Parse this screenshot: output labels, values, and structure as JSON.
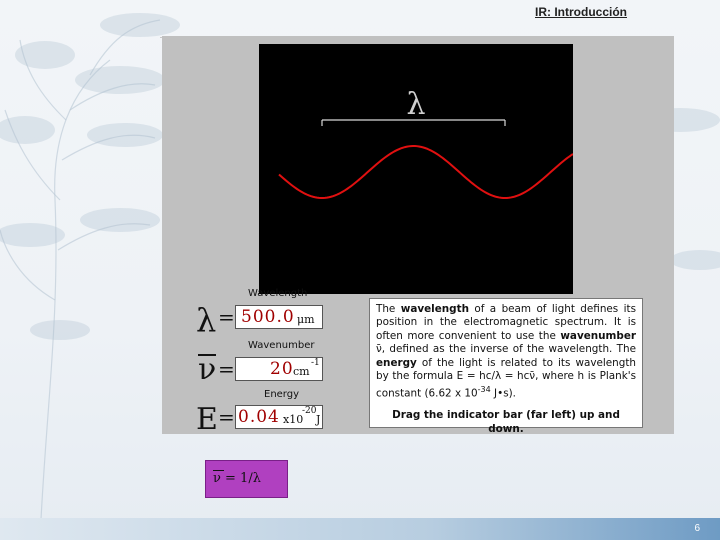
{
  "slide": {
    "title": "IR: Introducción",
    "page_number": "6"
  },
  "wave_panel": {
    "lambda_symbol": "λ",
    "wave_color": "#e01010"
  },
  "fields": {
    "wavelength": {
      "label": "Wavelength",
      "symbol": "λ",
      "equals": "=",
      "value": "500.0",
      "unit": "μm"
    },
    "wavenumber": {
      "label": "Wavenumber",
      "symbol": "ν",
      "equals": "=",
      "value": "20",
      "unit": "cm",
      "unit_exp": "-1"
    },
    "energy": {
      "label": "Energy",
      "symbol": "E",
      "equals": "=",
      "value": "0.04",
      "unit_prefix": "x10",
      "unit_exp": "-20",
      "unit": "J"
    }
  },
  "description": {
    "p1_a": "The ",
    "p1_b": "wavelength",
    "p1_c": " of a beam of light defines its position in the electromagnetic spectrum. It is often more convenient to use the ",
    "p1_d": "wavenumber",
    "p1_e": " ν̄, defined as the inverse of the wavelength. The ",
    "p1_f": "energy",
    "p1_g": " of the light is related to its wavelength by the formula E = hc/λ = hcν̄, where h is Plank's constant (6.62 x 10",
    "p1_exp": "-34",
    "p1_h": " J•s).",
    "instruction": "Drag the indicator bar (far left) up and down."
  },
  "formula": {
    "text": "ν = 1/λ"
  },
  "colors": {
    "title_rule": "#8b1a1a",
    "value_text": "#a00000",
    "formula_bg": "#b040c0",
    "applet_bg": "#c0c0c0"
  }
}
